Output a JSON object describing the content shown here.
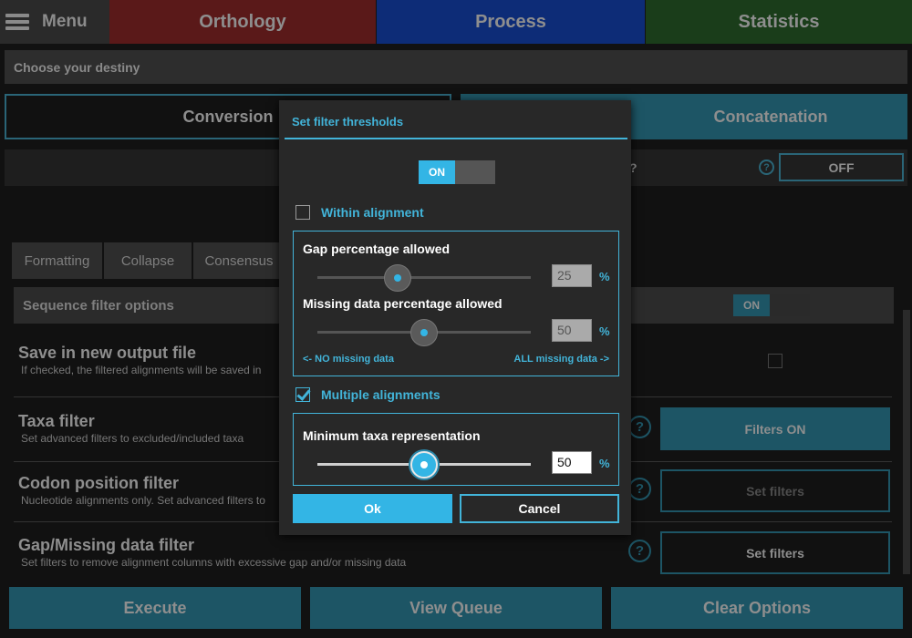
{
  "topbar": {
    "menu_label": "Menu",
    "tabs": [
      {
        "label": "Orthology",
        "color": "#5a1919"
      },
      {
        "label": "Process",
        "color": "#0d2c77"
      },
      {
        "label": "Statistics",
        "color": "#1a3d1a"
      }
    ]
  },
  "destiny_label": "Choose your destiny",
  "mode_buttons": {
    "conversion": "Conversion",
    "concatenation": "Concatenation"
  },
  "question_row": {
    "text": "?",
    "help": "?",
    "off_label": "OFF"
  },
  "subtabs": [
    "Formatting",
    "Collapse",
    "Consensus"
  ],
  "sequence_filter": {
    "label": "Sequence filter options",
    "toggle_on": "ON"
  },
  "options": {
    "save": {
      "title": "Save in new output file",
      "subtitle": "If checked, the filtered alignments will be saved in"
    },
    "taxa": {
      "title": "Taxa filter",
      "subtitle": "Set advanced filters to excluded/included taxa",
      "button": "Filters ON",
      "help": "?"
    },
    "codon": {
      "title": "Codon position filter",
      "subtitle": "Nucleotide alignments only. Set advanced filters to",
      "button": "Set filters",
      "help": "?"
    },
    "gap": {
      "title": "Gap/Missing data filter",
      "subtitle": "Set filters to remove alignment columns with excessive gap and/or missing data",
      "button": "Set filters",
      "help": "?"
    }
  },
  "bottom_bar": {
    "execute": "Execute",
    "view_queue": "View Queue",
    "clear_options": "Clear Options"
  },
  "dialog": {
    "title": "Set filter thresholds",
    "master_toggle": {
      "on_label": "ON",
      "state": "on"
    },
    "within_alignment": {
      "label": "Within alignment",
      "checked": false,
      "gap": {
        "label": "Gap percentage allowed",
        "value": "25",
        "unit": "%"
      },
      "missing": {
        "label": "Missing data percentage allowed",
        "value": "50",
        "unit": "%"
      },
      "hint_left": "<- NO missing data",
      "hint_right": "ALL missing data ->"
    },
    "multiple_alignments": {
      "label": "Multiple alignments",
      "checked": true,
      "min_taxa": {
        "label": "Minimum taxa representation",
        "value": "50",
        "unit": "%"
      }
    },
    "ok_label": "Ok",
    "cancel_label": "Cancel"
  },
  "colors": {
    "accent": "#33b5e5",
    "accent_dark": "#1d5565",
    "background": "#111111",
    "dialog": "#282828"
  }
}
